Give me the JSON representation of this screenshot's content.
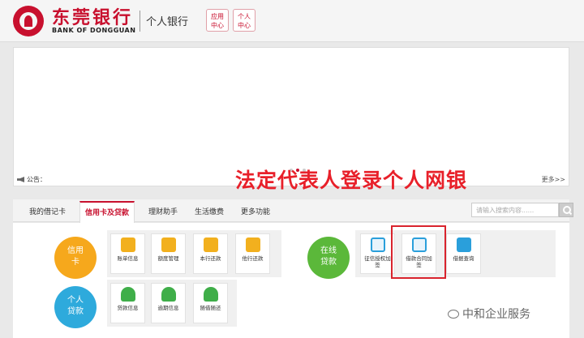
{
  "header": {
    "bank_name_cn": "东莞银行",
    "bank_name_en": "BANK OF DONGGUAN",
    "section": "个人银行",
    "app_center": [
      "应用",
      "中心"
    ],
    "personal_center": [
      "个人",
      "中心"
    ]
  },
  "notice": {
    "label": "公告：",
    "more": "更多>>"
  },
  "overlay": "法定代表人登录个人网银",
  "nav": {
    "tabs": [
      "我的借记卡",
      "信用卡及贷款",
      "理财助手",
      "生活缴费",
      "更多功能"
    ],
    "active_tab": "信用卡及贷款",
    "search_placeholder": "请输入搜索内容......"
  },
  "categories": {
    "credit": [
      "信用",
      "卡"
    ],
    "loan": [
      "个人",
      "贷款"
    ],
    "online": [
      "在线",
      "贷款"
    ]
  },
  "tiles": {
    "credit": [
      "账单信息",
      "额度管理",
      "本行还款",
      "他行还款"
    ],
    "loan": [
      "贷款信息",
      "逾期信息",
      "随借随还"
    ],
    "online": [
      [
        "征信授权加",
        "签"
      ],
      [
        "借款合同加",
        "签"
      ],
      [
        "借据查询",
        ""
      ]
    ]
  },
  "watermark": "中和企业服务",
  "colors": {
    "brand_red": "#c8102e",
    "credit_orange": "#f6a81c",
    "loan_blue": "#2eaadc",
    "online_green": "#5bb83a",
    "highlight_red": "#d9232d"
  },
  "icons": [
    "bank-logo-icon",
    "notice-speaker-icon",
    "search-icon",
    "wechat-icon"
  ]
}
